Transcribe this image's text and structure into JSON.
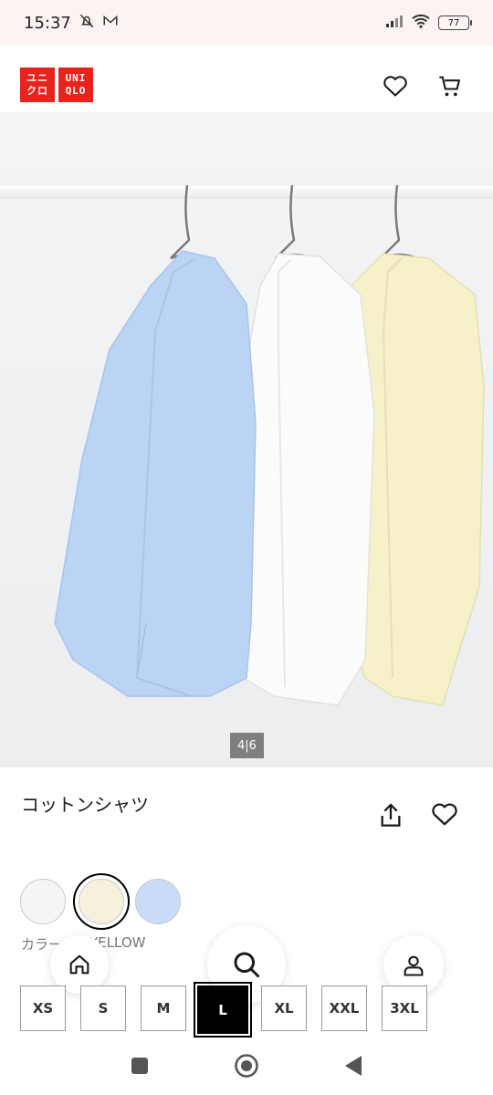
{
  "status_bar": {
    "time": "15:37",
    "battery": "77"
  },
  "header": {
    "logo_top": [
      "ユニ",
      "クロ"
    ],
    "logo_right": [
      "UNI",
      "QLO"
    ],
    "icons": [
      "heart-icon",
      "cart-icon"
    ]
  },
  "gallery": {
    "counter": "4|6"
  },
  "product": {
    "title": "コットンシャツ"
  },
  "colors": {
    "label": "カラー",
    "selected_value": "YELLOW",
    "swatches": [
      {
        "name": "white",
        "color": "#f5f5f5"
      },
      {
        "name": "yellow",
        "color": "#f6f1dc"
      },
      {
        "name": "blue",
        "color": "#c9dcf7"
      }
    ]
  },
  "sizes": {
    "options": [
      "XS",
      "S",
      "M",
      "L",
      "XL",
      "XXL",
      "3XL"
    ],
    "selected": "L"
  },
  "floating_nav": {
    "icons": [
      "home-icon",
      "search-icon",
      "user-icon"
    ]
  },
  "system_nav": {
    "icons": [
      "recents-icon",
      "home-circle-icon",
      "back-icon"
    ]
  }
}
